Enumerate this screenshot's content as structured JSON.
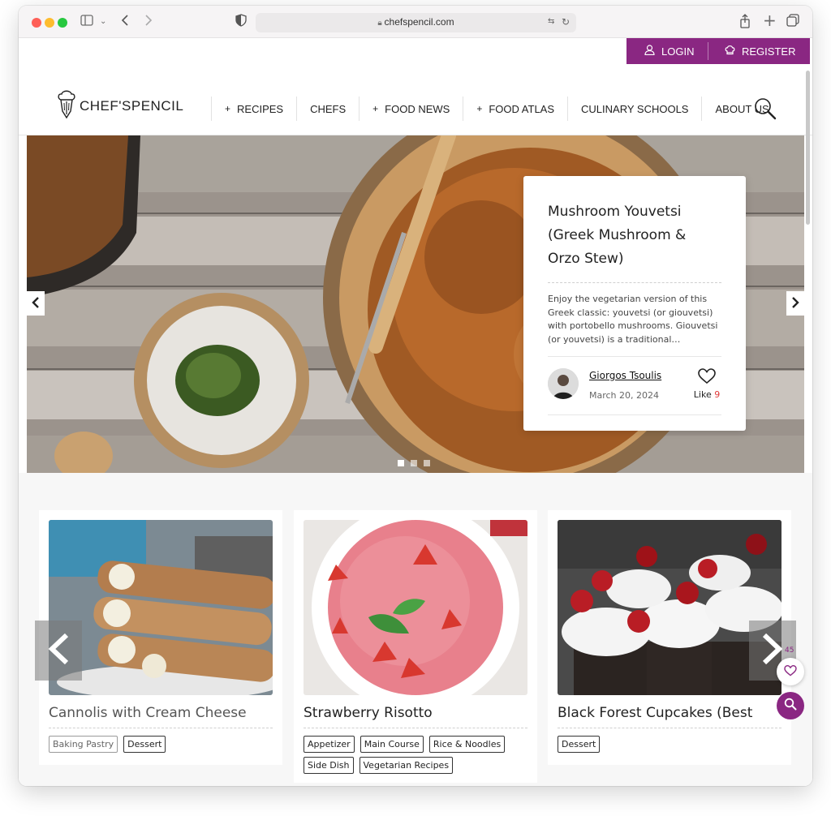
{
  "browser": {
    "url": "chefspencil.com",
    "icons": [
      "sidebar-icon",
      "chevron-down-icon",
      "back-icon",
      "forward-icon",
      "shield-icon",
      "lock-icon",
      "translate-icon",
      "reload-icon",
      "share-icon",
      "new-tab-icon",
      "tabs-overview-icon"
    ]
  },
  "topbar": {
    "login_label": "LOGIN",
    "register_label": "REGISTER",
    "accent": "#8a2782"
  },
  "nav": {
    "logo_text": "CHEF'SPENCIL",
    "items": [
      {
        "label": "RECIPES",
        "plus": "+"
      },
      {
        "label": "CHEFS",
        "plus": ""
      },
      {
        "label": "FOOD NEWS",
        "plus": "+"
      },
      {
        "label": "FOOD ATLAS",
        "plus": "+"
      },
      {
        "label": "CULINARY SCHOOLS",
        "plus": ""
      },
      {
        "label": "ABOUT US",
        "plus": ""
      }
    ]
  },
  "hero": {
    "title": "Mushroom Youvetsi (Greek Mushroom & Orzo Stew)",
    "description": "Enjoy the vegetarian version of this Greek classic: youvetsi (or giouvetsi) with portobello mushrooms. Giouvetsi (or youvetsi) is a traditional…",
    "author": "Giorgos Tsoulis",
    "date": "March 20, 2024",
    "like_label": "Like",
    "like_count": "9",
    "slides_total": 3,
    "active_slide": 1
  },
  "recipes": [
    {
      "title": "Cannolis with Cream Cheese",
      "tags": [
        "Baking Pastry",
        "Dessert"
      ]
    },
    {
      "title": "Strawberry Risotto",
      "tags": [
        "Appetizer",
        "Main Course",
        "Rice & Noodles",
        "Side Dish",
        "Vegetarian Recipes"
      ]
    },
    {
      "title": "Black Forest Cupcakes (Best",
      "tags": [
        "Dessert"
      ]
    }
  ],
  "floating": {
    "favorites_count": "45"
  }
}
